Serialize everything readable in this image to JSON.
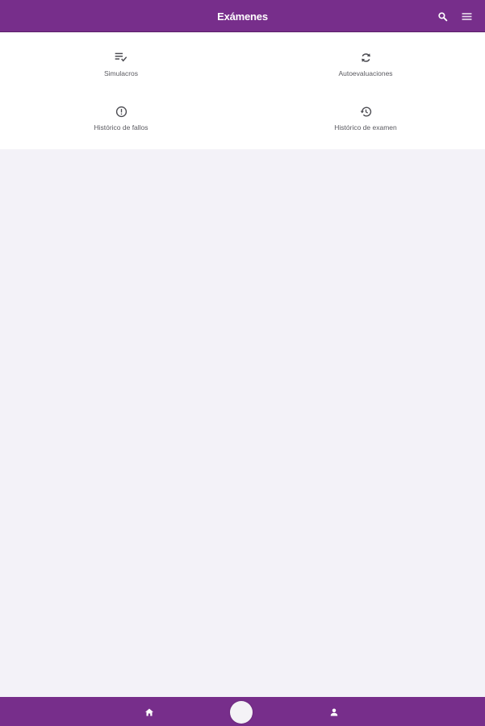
{
  "header": {
    "title": "Exámenes",
    "search_icon": "search-icon",
    "menu_icon": "menu-icon"
  },
  "menu": {
    "items": [
      {
        "label": "Simulacros",
        "icon": "checklist-icon"
      },
      {
        "label": "Autoevaluaciones",
        "icon": "refresh-icon"
      },
      {
        "label": "Histórico de fallos",
        "icon": "alert-circle-icon"
      },
      {
        "label": "Histórico de examen",
        "icon": "history-icon"
      }
    ]
  },
  "bottom_nav": {
    "items": [
      {
        "icon": "home-icon"
      },
      {
        "icon": "center-action-icon"
      },
      {
        "icon": "user-icon"
      }
    ]
  },
  "colors": {
    "brand": "#772e8b",
    "background": "#f3f2f8",
    "panel": "#ffffff",
    "label": "#5a5a60"
  }
}
